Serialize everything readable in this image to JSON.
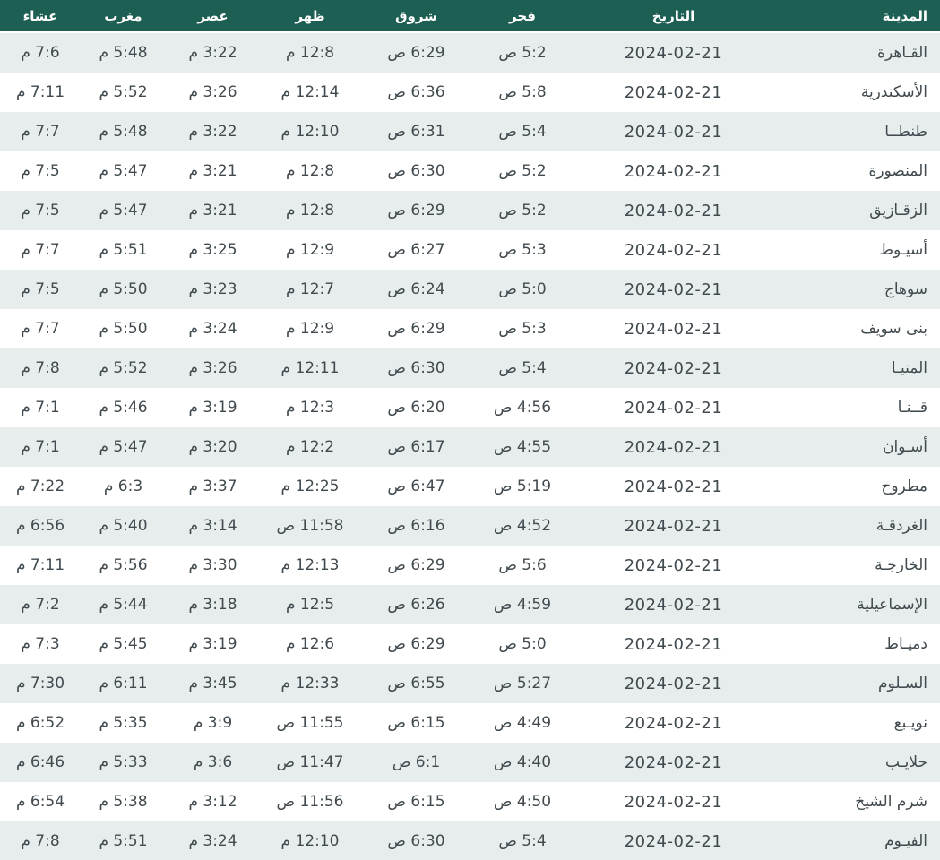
{
  "colors": {
    "header_bg": "#1e5f54",
    "header_text": "#ffffff",
    "row_alt_bg": "#e7eced",
    "row_bg": "#ffffff",
    "cell_text": "#414a4f"
  },
  "table": {
    "columns": [
      {
        "key": "city",
        "label": "المدينة"
      },
      {
        "key": "date",
        "label": "التاريخ"
      },
      {
        "key": "fajr",
        "label": "فجر"
      },
      {
        "key": "shorouk",
        "label": "شروق"
      },
      {
        "key": "dhuhr",
        "label": "ظهر"
      },
      {
        "key": "asr",
        "label": "عصر"
      },
      {
        "key": "maghrib",
        "label": "مغرب"
      },
      {
        "key": "isha",
        "label": "عشاء"
      }
    ],
    "rows": [
      {
        "city": "القـاهرة",
        "date": "2024-02-21",
        "fajr": "5:2 ص",
        "shorouk": "6:29 ص",
        "dhuhr": "12:8 م",
        "asr": "3:22 م",
        "maghrib": "5:48 م",
        "isha": "7:6 م"
      },
      {
        "city": "الأسكندرية",
        "date": "2024-02-21",
        "fajr": "5:8 ص",
        "shorouk": "6:36 ص",
        "dhuhr": "12:14 م",
        "asr": "3:26 م",
        "maghrib": "5:52 م",
        "isha": "7:11 م"
      },
      {
        "city": "طنطــا",
        "date": "2024-02-21",
        "fajr": "5:4 ص",
        "shorouk": "6:31 ص",
        "dhuhr": "12:10 م",
        "asr": "3:22 م",
        "maghrib": "5:48 م",
        "isha": "7:7 م"
      },
      {
        "city": "المنصورة",
        "date": "2024-02-21",
        "fajr": "5:2 ص",
        "shorouk": "6:30 ص",
        "dhuhr": "12:8 م",
        "asr": "3:21 م",
        "maghrib": "5:47 م",
        "isha": "7:5 م"
      },
      {
        "city": "الزقـازيق",
        "date": "2024-02-21",
        "fajr": "5:2 ص",
        "shorouk": "6:29 ص",
        "dhuhr": "12:8 م",
        "asr": "3:21 م",
        "maghrib": "5:47 م",
        "isha": "7:5 م"
      },
      {
        "city": "أسيـوط",
        "date": "2024-02-21",
        "fajr": "5:3 ص",
        "shorouk": "6:27 ص",
        "dhuhr": "12:9 م",
        "asr": "3:25 م",
        "maghrib": "5:51 م",
        "isha": "7:7 م"
      },
      {
        "city": "سوهاج",
        "date": "2024-02-21",
        "fajr": "5:0 ص",
        "shorouk": "6:24 ص",
        "dhuhr": "12:7 م",
        "asr": "3:23 م",
        "maghrib": "5:50 م",
        "isha": "7:5 م"
      },
      {
        "city": "بنى سويف",
        "date": "2024-02-21",
        "fajr": "5:3 ص",
        "shorouk": "6:29 ص",
        "dhuhr": "12:9 م",
        "asr": "3:24 م",
        "maghrib": "5:50 م",
        "isha": "7:7 م"
      },
      {
        "city": "المنيـا",
        "date": "2024-02-21",
        "fajr": "5:4 ص",
        "shorouk": "6:30 ص",
        "dhuhr": "12:11 م",
        "asr": "3:26 م",
        "maghrib": "5:52 م",
        "isha": "7:8 م"
      },
      {
        "city": "قــنـا",
        "date": "2024-02-21",
        "fajr": "4:56 ص",
        "shorouk": "6:20 ص",
        "dhuhr": "12:3 م",
        "asr": "3:19 م",
        "maghrib": "5:46 م",
        "isha": "7:1 م"
      },
      {
        "city": "أسـوان",
        "date": "2024-02-21",
        "fajr": "4:55 ص",
        "shorouk": "6:17 ص",
        "dhuhr": "12:2 م",
        "asr": "3:20 م",
        "maghrib": "5:47 م",
        "isha": "7:1 م"
      },
      {
        "city": "مطروح",
        "date": "2024-02-21",
        "fajr": "5:19 ص",
        "shorouk": "6:47 ص",
        "dhuhr": "12:25 م",
        "asr": "3:37 م",
        "maghrib": "6:3 م",
        "isha": "7:22 م"
      },
      {
        "city": "الغردقـة",
        "date": "2024-02-21",
        "fajr": "4:52 ص",
        "shorouk": "6:16 ص",
        "dhuhr": "11:58 ص",
        "asr": "3:14 م",
        "maghrib": "5:40 م",
        "isha": "6:56 م"
      },
      {
        "city": "الخارجـة",
        "date": "2024-02-21",
        "fajr": "5:6 ص",
        "shorouk": "6:29 ص",
        "dhuhr": "12:13 م",
        "asr": "3:30 م",
        "maghrib": "5:56 م",
        "isha": "7:11 م"
      },
      {
        "city": "الإسماعيلية",
        "date": "2024-02-21",
        "fajr": "4:59 ص",
        "shorouk": "6:26 ص",
        "dhuhr": "12:5 م",
        "asr": "3:18 م",
        "maghrib": "5:44 م",
        "isha": "7:2 م"
      },
      {
        "city": "دميـاط",
        "date": "2024-02-21",
        "fajr": "5:0 ص",
        "shorouk": "6:29 ص",
        "dhuhr": "12:6 م",
        "asr": "3:19 م",
        "maghrib": "5:45 م",
        "isha": "7:3 م"
      },
      {
        "city": "السـلوم",
        "date": "2024-02-21",
        "fajr": "5:27 ص",
        "shorouk": "6:55 ص",
        "dhuhr": "12:33 م",
        "asr": "3:45 م",
        "maghrib": "6:11 م",
        "isha": "7:30 م"
      },
      {
        "city": "نويـبع",
        "date": "2024-02-21",
        "fajr": "4:49 ص",
        "shorouk": "6:15 ص",
        "dhuhr": "11:55 ص",
        "asr": "3:9 م",
        "maghrib": "5:35 م",
        "isha": "6:52 م"
      },
      {
        "city": "حلايـب",
        "date": "2024-02-21",
        "fajr": "4:40 ص",
        "shorouk": "6:1 ص",
        "dhuhr": "11:47 ص",
        "asr": "3:6 م",
        "maghrib": "5:33 م",
        "isha": "6:46 م"
      },
      {
        "city": "شرم الشيخ",
        "date": "2024-02-21",
        "fajr": "4:50 ص",
        "shorouk": "6:15 ص",
        "dhuhr": "11:56 ص",
        "asr": "3:12 م",
        "maghrib": "5:38 م",
        "isha": "6:54 م"
      },
      {
        "city": "الفيـوم",
        "date": "2024-02-21",
        "fajr": "5:4 ص",
        "shorouk": "6:30 ص",
        "dhuhr": "12:10 م",
        "asr": "3:24 م",
        "maghrib": "5:51 م",
        "isha": "7:8 م"
      }
    ]
  }
}
